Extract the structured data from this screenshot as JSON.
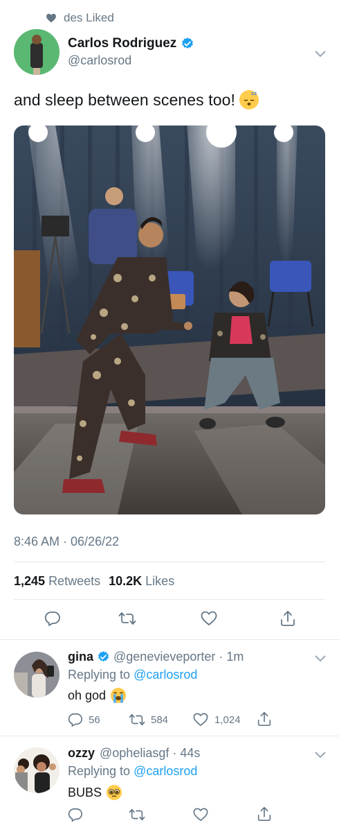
{
  "context": {
    "icon": "heart-icon",
    "user": "des",
    "action": "Liked"
  },
  "tweet": {
    "author_name": "Carlos Rodriguez",
    "author_handle": "@carlosrod",
    "verified": true,
    "text": "and sleep between scenes too!",
    "emoji": "sleeping-face",
    "timestamp": "8:46 AM · 06/26/22",
    "retweets_count": "1,245",
    "retweets_label": "Retweets",
    "likes_count": "10.2K",
    "likes_label": "Likes"
  },
  "replies": [
    {
      "name": "gina",
      "verified": true,
      "handle": "@genevieveporter",
      "time": "· 1m",
      "replying_prefix": "Replying to",
      "replying_to": "@carlosrod",
      "text": "oh god",
      "emoji": "loudly-crying-face",
      "reply_count": "56",
      "retweet_count": "584",
      "like_count": "1,024"
    },
    {
      "name": "ozzy",
      "verified": false,
      "handle": "@opheliasgf",
      "time": "· 44s",
      "replying_prefix": "Replying to",
      "replying_to": "@carlosrod",
      "text": "BUBS",
      "emoji": "pleading-face"
    }
  ],
  "colors": {
    "accent": "#1da1f2",
    "secondary_text": "#657786",
    "divider": "#e1e8ed"
  }
}
